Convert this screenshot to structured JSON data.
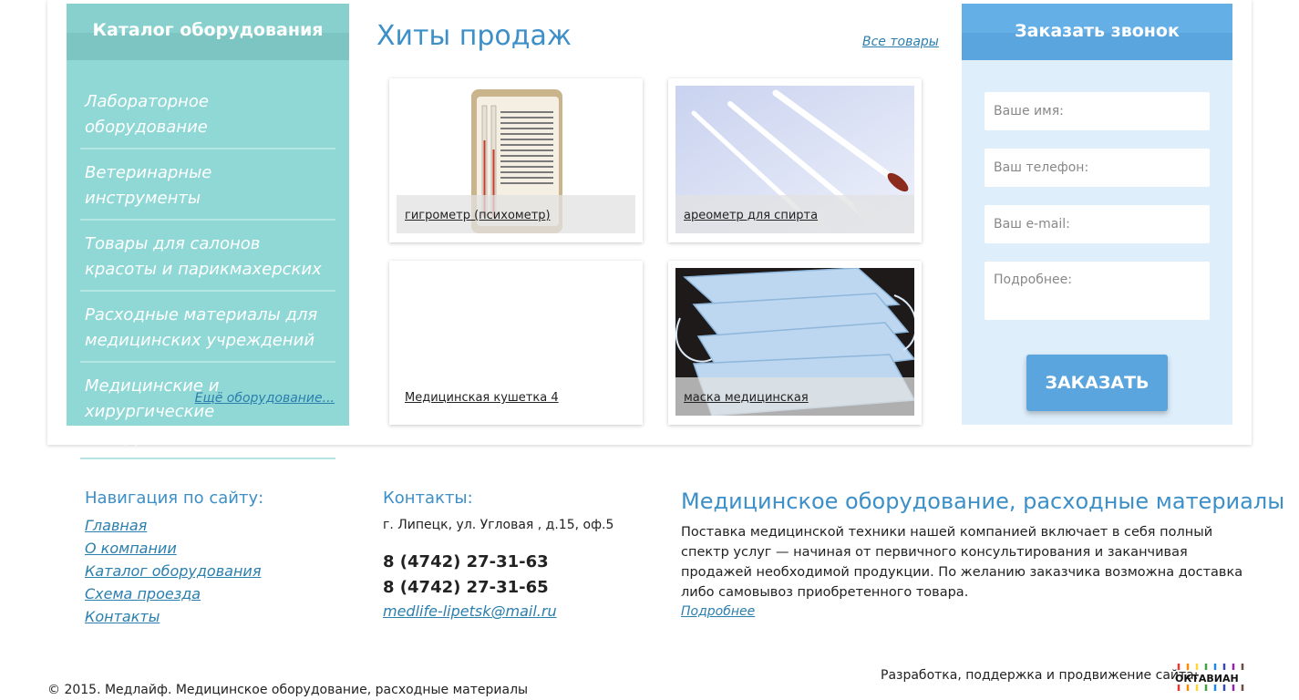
{
  "catalog": {
    "title": "Каталог оборудования",
    "items": [
      "Лабораторное оборудование",
      "Ветеринарные инструменты",
      "Товары для салонов красоты и парикмахерских",
      "Расходные материалы для медицинских учреждений",
      "Медицинские и хирургические инструменты"
    ],
    "more": "Ещё оборудование..."
  },
  "hits": {
    "title": "Хиты продаж",
    "all_link": "Все товары",
    "products": [
      {
        "name": "гигрометр (психометр)"
      },
      {
        "name": "ареометр для спирта"
      },
      {
        "name": "Медицинская кушетка 4"
      },
      {
        "name": "маска медицинская"
      }
    ]
  },
  "order": {
    "title": "Заказать звонок",
    "name_placeholder": "Ваше имя:",
    "phone_placeholder": "Ваш телефон:",
    "email_placeholder": "Ваш e-mail:",
    "details_placeholder": "Подробнее:",
    "button": "ЗАКАЗАТЬ"
  },
  "footer": {
    "nav_title": "Навигация по сайту:",
    "nav": [
      "Главная",
      "О компании",
      "Каталог оборудования",
      "Схема проезда",
      "Контакты"
    ],
    "contacts_title": "Контакты:",
    "address": "г. Липецк, ул. Угловая , д.15, оф.5",
    "phone1": "8 (4742) 27-31-63",
    "phone2": "8 (4742) 27-31-65",
    "email": "medlife-lipetsk@mail.ru",
    "about_title": "Медицинское оборудование, расходные материалы",
    "about_text": "Поставка медицинской техники нашей компанией включает в себя полный спектр услуг — начиная от первичного консультирования и заканчивая продажей необходимой продукции. По желанию заказчика возможна доставка либо самовывоз приобретенного товара.",
    "about_more": "Подробнее",
    "dev_text": "Разработка, поддержка и продвижение сайта:",
    "dev_logo": "ОКТАВИАН",
    "copyright": "© 2015. Медлайф. Медицинское оборудование, расходные материалы"
  }
}
